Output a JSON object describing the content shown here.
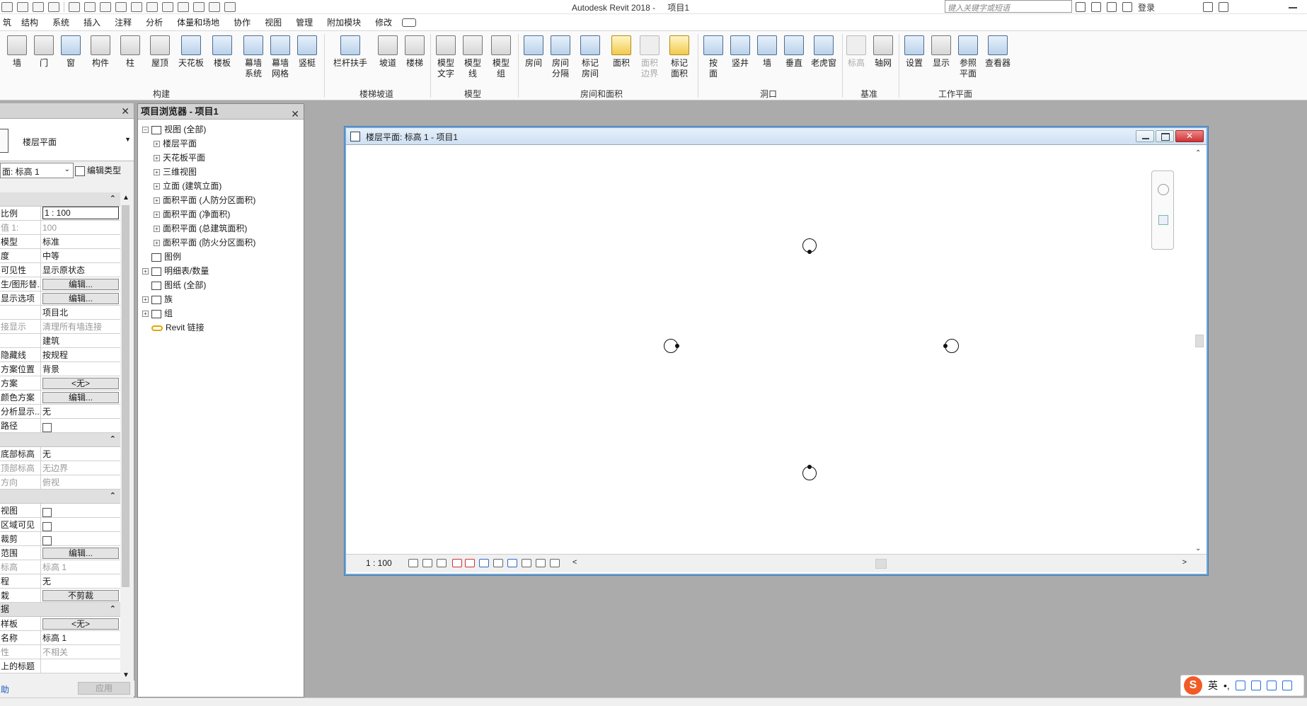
{
  "app": {
    "title": "Autodesk Revit 2018 -",
    "project": "项目1",
    "search_placeholder": "键入关键字或短语",
    "login": "登录"
  },
  "menu": {
    "active": "筑",
    "tabs": [
      "结构",
      "系统",
      "插入",
      "注释",
      "分析",
      "体量和场地",
      "协作",
      "视图",
      "管理",
      "附加模块",
      "修改"
    ]
  },
  "ribbon": {
    "build": {
      "label": "构建",
      "wall": "墙",
      "door": "门",
      "window": "窗",
      "component": "构件",
      "column": "柱",
      "roof": "屋顶",
      "ceiling": "天花板",
      "floor": "楼板",
      "curtain_system": [
        "幕墙",
        "系统"
      ],
      "curtain_grid": [
        "幕墙",
        "网格"
      ],
      "mullion": "竖梃"
    },
    "stairs": {
      "label": "楼梯坡道",
      "railing": "栏杆扶手",
      "ramp": "坡道",
      "stair": "楼梯"
    },
    "model": {
      "label": "模型",
      "text": [
        "模型",
        "文字"
      ],
      "line": [
        "模型",
        "线"
      ],
      "group": [
        "模型",
        "组"
      ]
    },
    "room": {
      "label": "房间和面积",
      "room": "房间",
      "separator": [
        "房间",
        "分隔"
      ],
      "tag_room": [
        "标记",
        "房间"
      ],
      "area": "面积",
      "area_boundary": [
        "面积",
        "边界"
      ],
      "tag_area": [
        "标记",
        "面积"
      ]
    },
    "opening": {
      "label": "洞口",
      "by_face": [
        "按",
        "面"
      ],
      "shaft": "竖井",
      "wall": "墙",
      "vertical": "垂直",
      "dormer": "老虎窗"
    },
    "datum": {
      "label": "基准",
      "level": "标高",
      "grid": "轴网"
    },
    "workplane": {
      "label": "工作平面",
      "set": "设置",
      "show": "显示",
      "ref_plane": [
        "参照",
        "平面"
      ],
      "viewer": "查看器"
    }
  },
  "properties": {
    "type_name": "楼层平面",
    "view_selector": "面: 标高 1",
    "edit_type": "编辑类型",
    "rows": [
      {
        "k": "比例",
        "v": "1 : 100",
        "kind": "boxed"
      },
      {
        "k": "值 1:",
        "v": "100",
        "kind": "grey"
      },
      {
        "k": "模型",
        "v": "标准"
      },
      {
        "k": "度",
        "v": "中等"
      },
      {
        "k": "可见性",
        "v": "显示原状态"
      },
      {
        "k": "生/图形替...",
        "v": "编辑...",
        "kind": "btn"
      },
      {
        "k": "显示选项",
        "v": "编辑...",
        "kind": "btn"
      },
      {
        "k": "",
        "v": "项目北"
      },
      {
        "k": "接显示",
        "v": "清理所有墙连接",
        "kind": "grey"
      },
      {
        "k": "",
        "v": "建筑"
      },
      {
        "k": "隐藏线",
        "v": "按规程"
      },
      {
        "k": "方案位置",
        "v": "背景"
      },
      {
        "k": "方案",
        "v": "<无>",
        "kind": "btn"
      },
      {
        "k": "颜色方案",
        "v": "编辑...",
        "kind": "btn"
      },
      {
        "k": "分析显示...",
        "v": "无"
      },
      {
        "k": "路径",
        "v": "",
        "kind": "check"
      }
    ],
    "rows2": [
      {
        "k": "底部标高",
        "v": "无"
      },
      {
        "k": "顶部标高",
        "v": "无边界",
        "kind": "grey"
      },
      {
        "k": "方向",
        "v": "俯视",
        "kind": "grey"
      }
    ],
    "rows3": [
      {
        "k": "视图",
        "v": "",
        "kind": "check"
      },
      {
        "k": "区域可见",
        "v": "",
        "kind": "check"
      },
      {
        "k": "裁剪",
        "v": "",
        "kind": "check"
      },
      {
        "k": "范围",
        "v": "编辑...",
        "kind": "btn"
      },
      {
        "k": "标高",
        "v": "标高 1",
        "kind": "grey"
      },
      {
        "k": "程",
        "v": "无"
      },
      {
        "k": "栽",
        "v": "不剪裁",
        "kind": "btn"
      }
    ],
    "rows4": [
      {
        "k": "样板",
        "v": "<无>",
        "kind": "btn"
      },
      {
        "k": "名称",
        "v": "标高 1"
      },
      {
        "k": "性",
        "v": "不相关",
        "kind": "grey"
      },
      {
        "k": "上的标题",
        "v": ""
      }
    ],
    "section4_label": "据",
    "help": "助",
    "apply": "应用"
  },
  "browser": {
    "title": "项目浏览器 - 项目1",
    "nodes": [
      {
        "label": "视图 (全部)",
        "level": 0,
        "exp": "−"
      },
      {
        "label": "楼层平面",
        "level": 1,
        "exp": "+"
      },
      {
        "label": "天花板平面",
        "level": 1,
        "exp": "+"
      },
      {
        "label": "三维视图",
        "level": 1,
        "exp": "+"
      },
      {
        "label": "立面 (建筑立面)",
        "level": 1,
        "exp": "+"
      },
      {
        "label": "面积平面 (人防分区面积)",
        "level": 1,
        "exp": "+"
      },
      {
        "label": "面积平面 (净面积)",
        "level": 1,
        "exp": "+"
      },
      {
        "label": "面积平面 (总建筑面积)",
        "level": 1,
        "exp": "+"
      },
      {
        "label": "面积平面 (防火分区面积)",
        "level": 1,
        "exp": "+"
      },
      {
        "label": "图例",
        "level": 0,
        "exp": ""
      },
      {
        "label": "明细表/数量",
        "level": 0,
        "exp": "+"
      },
      {
        "label": "图纸 (全部)",
        "level": 0,
        "exp": ""
      },
      {
        "label": "族",
        "level": 0,
        "exp": "+"
      },
      {
        "label": "组",
        "level": 0,
        "exp": "+"
      },
      {
        "label": "Revit 链接",
        "level": 0,
        "exp": "",
        "link": true
      }
    ]
  },
  "view": {
    "title": "楼层平面: 标高 1 - 项目1",
    "scale": "1 : 100"
  },
  "ime": {
    "logo": "S",
    "lang": "英",
    "punct": "•,"
  }
}
